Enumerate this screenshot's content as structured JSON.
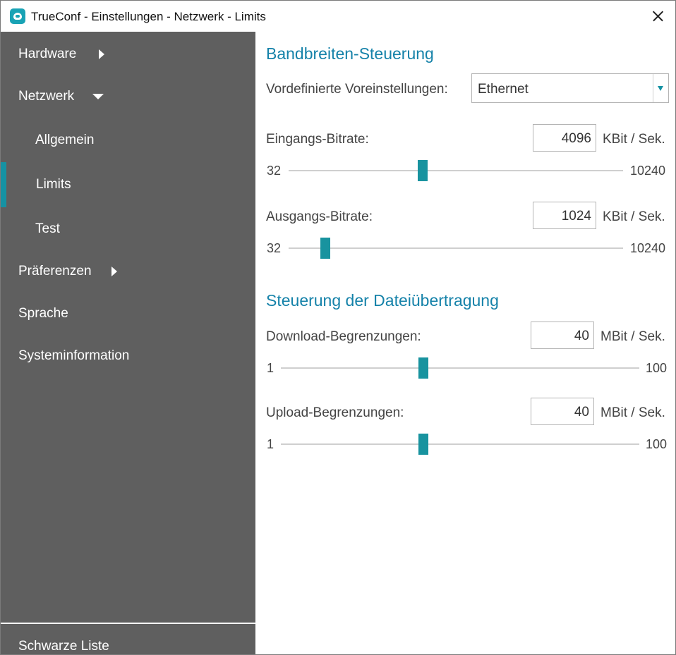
{
  "window": {
    "title": "TrueConf - Einstellungen - Netzwerk - Limits"
  },
  "sidebar": {
    "items": [
      {
        "label": "Hardware"
      },
      {
        "label": "Netzwerk"
      },
      {
        "label": "Allgemein"
      },
      {
        "label": "Limits"
      },
      {
        "label": "Test"
      },
      {
        "label": "Präferenzen"
      },
      {
        "label": "Sprache"
      },
      {
        "label": "Systeminformation"
      }
    ],
    "bottom_item": {
      "label": "Schwarze Liste"
    }
  },
  "bandwidth": {
    "title": "Bandbreiten-Steuerung",
    "preset": {
      "label": "Vordefinierte Voreinstellungen:",
      "value": "Ethernet"
    },
    "incoming": {
      "label": "Eingangs-Bitrate:",
      "value": "4096",
      "unit": "KBit / Sek.",
      "min": "32",
      "max": "10240",
      "level": 4096
    },
    "outgoing": {
      "label": "Ausgangs-Bitrate:",
      "value": "1024",
      "unit": "KBit / Sek.",
      "min": "32",
      "max": "10240",
      "level": 1024
    }
  },
  "file_transfer": {
    "title": "Steuerung der Dateiübertragung",
    "download": {
      "label": "Download-Begrenzungen:",
      "value": "40",
      "unit": "MBit / Sek.",
      "min": "1",
      "max": "100",
      "level": 40
    },
    "upload": {
      "label": "Upload-Begrenzungen:",
      "value": "40",
      "unit": "MBit / Sek.",
      "min": "1",
      "max": "100",
      "level": 40
    }
  },
  "colors": {
    "accent": "#1592a3",
    "section_title": "#1582a9",
    "sidebar_bg": "#5f5f5f"
  },
  "icons": {
    "app": "trueconf-logo-icon",
    "close": "close-icon",
    "expand": "chevron-right-icon",
    "collapse": "chevron-down-icon"
  }
}
